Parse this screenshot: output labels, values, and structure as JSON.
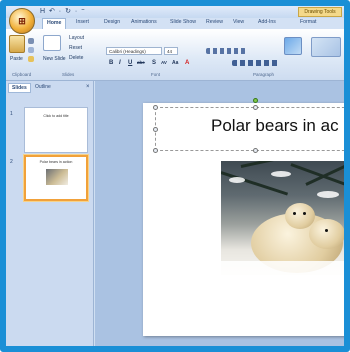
{
  "qat": {
    "label": "H  ↶ · ↻ ·  ⁼"
  },
  "window": {
    "title": ""
  },
  "context_tab": {
    "label": "Drawing Tools"
  },
  "tabs": [
    "Home",
    "Insert",
    "Design",
    "Animations",
    "Slide Show",
    "Review",
    "View",
    "Add-Ins",
    "Format"
  ],
  "ribbon": {
    "paste_label": "Paste",
    "new_slide_label": "New Slide",
    "layout_label": "Layout",
    "reset_label": "Reset",
    "delete_label": "Delete",
    "font_value": "Calibri (Headings)",
    "font_size": "44",
    "groups": [
      "Clipboard",
      "Slides",
      "Font",
      "Paragraph"
    ],
    "format_buttons": [
      "B",
      "I",
      "U",
      "abe",
      "S",
      "AV",
      "Aa",
      "A"
    ]
  },
  "pane": {
    "tabs": [
      "Slides",
      "Outline"
    ],
    "close": "×",
    "slides": [
      {
        "num": "1",
        "title": "Click to add title",
        "subtitle": ""
      },
      {
        "num": "2",
        "title": "Polar bears in action",
        "subtitle": ""
      }
    ]
  },
  "slide": {
    "title": "Polar bears in ac"
  },
  "colors": {
    "frame": "#1a8fd6",
    "ribbon": "#dde8f6",
    "accent": "#f1a13a",
    "workspace": "#aac2e2"
  }
}
